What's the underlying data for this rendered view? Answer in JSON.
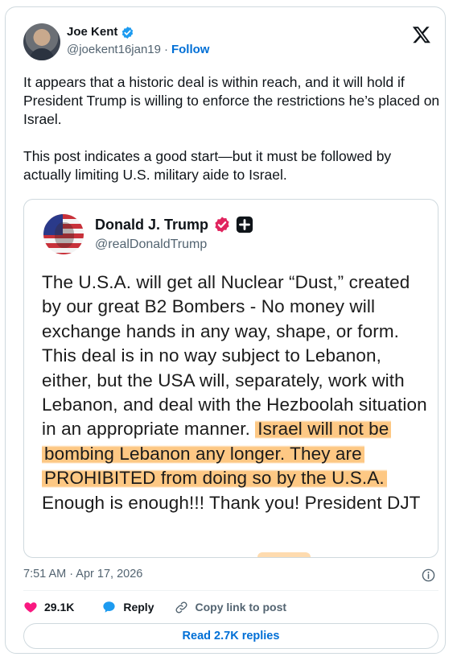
{
  "author": {
    "name": "Joe Kent",
    "handle": "@joekent16jan19",
    "separator": "·",
    "follow_label": "Follow"
  },
  "post": {
    "text": "It appears that a historic deal is within reach, and it will hold if President Trump is willing to enforce the restrictions he’s placed on Israel.\n\nThis post indicates a good start—but it must be followed by actually limiting U.S. military aide to Israel."
  },
  "quoted": {
    "name": "Donald J. Trump",
    "handle": "@realDonaldTrump",
    "text_plain": "The U.S.A. will get all Nuclear “Dust,” created by our great B2 Bombers - No money will exchange hands in any way, shape, or form. This deal is in no way subject to Lebanon, either, but the USA will, separately, work with Lebanon, and deal with the Hezboolah situation in an appropriate manner. ",
    "text_highlighted": "Israel will not be bombing Lebanon any longer. They are PROHIBITED from doing so by the U.S.A.",
    "text_tail": " Enough is enough!!! Thank you! President DJT",
    "highlight_color": "#fdbe6e"
  },
  "meta": {
    "timestamp": "7:51 AM · Apr 17, 2026"
  },
  "actions": {
    "likes": "29.1K",
    "reply_label": "Reply",
    "copy_label": "Copy link to post",
    "read_replies_label": "Read 2.7K replies"
  },
  "colors": {
    "accent": "#006fd6",
    "verified": "#1d9bf0",
    "like": "#f91880",
    "reply": "#1d9bf0",
    "trump_badge": "#e0245e"
  },
  "icons": {
    "x_logo": "x-logo-icon",
    "verified": "verified-badge-icon",
    "info": "info-icon",
    "heart": "heart-icon",
    "reply": "reply-icon",
    "link": "link-icon"
  }
}
